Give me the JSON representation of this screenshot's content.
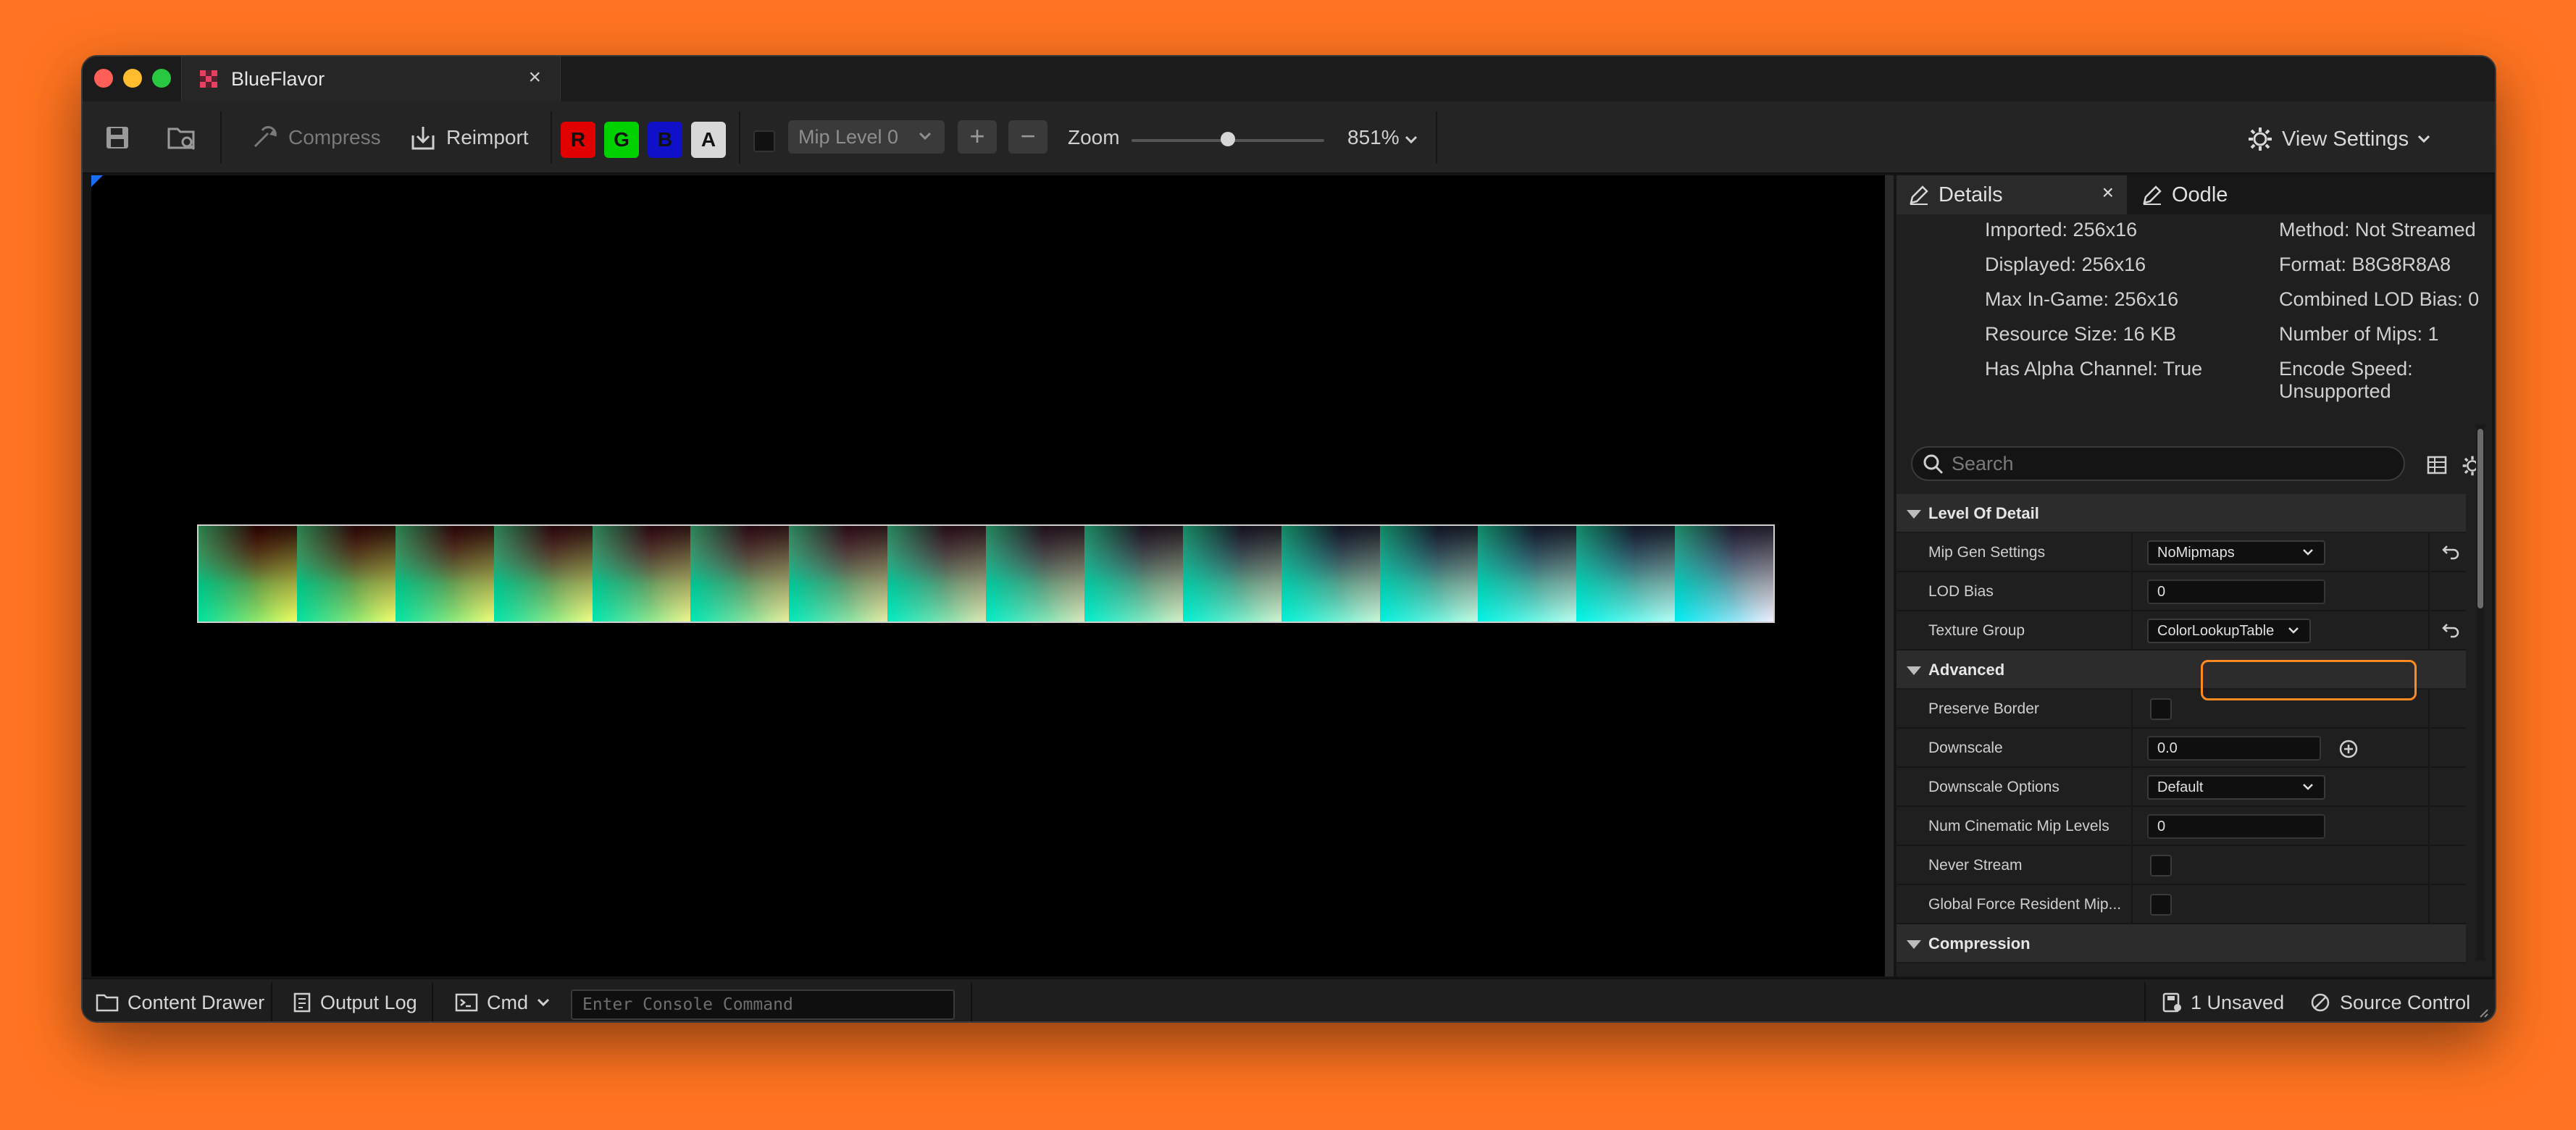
{
  "window": {
    "tab_title": "BlueFlavor",
    "tab_close": "×"
  },
  "toolbar": {
    "compress": "Compress",
    "reimport": "Reimport",
    "channels": [
      "R",
      "G",
      "B",
      "A"
    ],
    "mip_level": "Mip Level 0",
    "plus": "+",
    "minus": "−",
    "zoom_label": "Zoom",
    "zoom_value": "851%",
    "zoom_slider_fraction": 0.5,
    "view_settings": "View Settings"
  },
  "colors": {
    "accent": "#ff7420",
    "highlight": "#ff8a22",
    "channel_r": "#e00000",
    "channel_g": "#00d000",
    "channel_b": "#1010c8",
    "channel_a": "#d8d8d8"
  },
  "lut_cells": [
    [
      "#ff0a0a",
      "#00c878",
      "#f0ff60"
    ],
    [
      "#ff1c1c",
      "#00c878",
      "#f3ff6c"
    ],
    [
      "#ff1c2e",
      "#00cc80",
      "#f0ff78"
    ],
    [
      "#ff2248",
      "#00cc88",
      "#f0ff84"
    ],
    [
      "#ff2c5e",
      "#00d090",
      "#f0f890"
    ],
    [
      "#ff3870",
      "#00d098",
      "#eaf09c"
    ],
    [
      "#ff4482",
      "#00d4a0",
      "#e6eca6"
    ],
    [
      "#e85090",
      "#00d8a8",
      "#e0e8b2"
    ],
    [
      "#c85aa0",
      "#00dcb0",
      "#daeabc"
    ],
    [
      "#a864b0",
      "#00dcb8",
      "#d6f0c6"
    ],
    [
      "#886cc0",
      "#00e0c0",
      "#d0f4d0"
    ],
    [
      "#7074d0",
      "#00e4c8",
      "#caf8da"
    ],
    [
      "#6c7cdc",
      "#00e4d0",
      "#c4fce4"
    ],
    [
      "#6c84e8",
      "#00e8d8",
      "#bcffee"
    ],
    [
      "#7088f0",
      "#00ecde",
      "#b6fff6"
    ],
    [
      "#b090ff",
      "#00d8ea",
      "#f0f0ff"
    ]
  ],
  "details": {
    "tab_details": "Details",
    "tab_close": "×",
    "tab_oodle": "Oodle",
    "info_left": [
      "Imported: 256x16",
      "Displayed: 256x16",
      "Max In-Game: 256x16",
      "Resource Size: 16 KB",
      "Has Alpha Channel: True"
    ],
    "info_right": [
      "Method: Not Streamed",
      "Format: B8G8R8A8",
      "Combined LOD Bias: 0",
      "Number of Mips: 1",
      "Encode Speed: Unsupported"
    ],
    "search_placeholder": "Search",
    "cat_lod": "Level Of Detail",
    "mip_gen_label": "Mip Gen Settings",
    "mip_gen_value": "NoMipmaps",
    "lod_bias_label": "LOD Bias",
    "lod_bias_value": "0",
    "texture_group_label": "Texture Group",
    "texture_group_value": "ColorLookupTable",
    "cat_advanced": "Advanced",
    "preserve_border_label": "Preserve Border",
    "downscale_label": "Downscale",
    "downscale_value": "0.0",
    "downscale_options_label": "Downscale Options",
    "downscale_options_value": "Default",
    "num_cinematic_label": "Num Cinematic Mip Levels",
    "num_cinematic_value": "0",
    "never_stream_label": "Never Stream",
    "global_force_label": "Global Force Resident Mip...",
    "cat_compression": "Compression"
  },
  "statusbar": {
    "content_drawer": "Content Drawer",
    "output_log": "Output Log",
    "cmd": "Cmd",
    "console_placeholder": "Enter Console Command",
    "unsaved": "1 Unsaved",
    "source_control": "Source Control"
  }
}
